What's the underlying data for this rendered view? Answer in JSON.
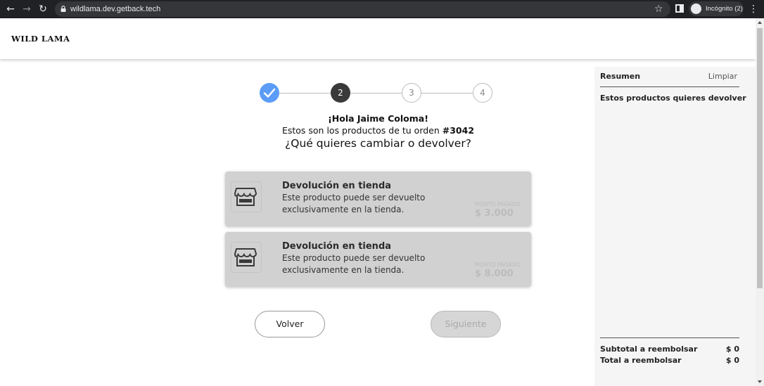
{
  "browser": {
    "url": "wildlama.dev.getback.tech",
    "incognito_label": "Incógnito (2)"
  },
  "header": {
    "brand": "WILD LAMA"
  },
  "stepper": {
    "steps": [
      {
        "label": "",
        "state": "done"
      },
      {
        "label": "2",
        "state": "current"
      },
      {
        "label": "3",
        "state": "todo"
      },
      {
        "label": "4",
        "state": "todo"
      }
    ]
  },
  "intro": {
    "greeting": "¡Hola Jaime Coloma!",
    "orders_text": "Estos son los productos de tu orden",
    "order_number": "#3042",
    "question": "¿Qué quieres cambiar o devolver?"
  },
  "products": [
    {
      "title": "Devolución en tienda",
      "description": "Este producto puede ser devuelto exclusivamente en la tienda.",
      "amount_label": "MONTO PAGADO",
      "amount": "$ 3.000"
    },
    {
      "title": "Devolución en tienda",
      "description": "Este producto puede ser devuelto exclusivamente en la tienda.",
      "amount_label": "MONTO PAGADO",
      "amount": "$ 8.000"
    }
  ],
  "actions": {
    "back_label": "Volver",
    "next_label": "Siguiente"
  },
  "summary": {
    "title": "Resumen",
    "clear_label": "Limpiar",
    "subtitle": "Estos productos quieres devolver",
    "subtotal_label": "Subtotal a reembolsar",
    "subtotal_value": "$ 0",
    "total_label": "Total a reembolsar",
    "total_value": "$ 0"
  },
  "colors": {
    "step_done": "#5b9cf6",
    "step_current": "#3a3a3a",
    "card_bg": "#d1d1d1"
  }
}
